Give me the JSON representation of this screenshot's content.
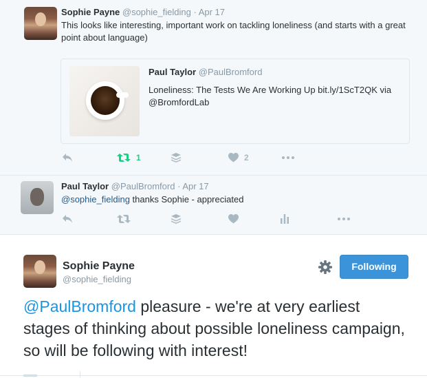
{
  "tweet1": {
    "name": "Sophie Payne",
    "handle": "@sophie_fielding",
    "dot": "·",
    "date": "Apr 17",
    "text": "This looks like interesting, important work on tackling loneliness (and starts with a great point about language)",
    "quote": {
      "name": "Paul Taylor",
      "handle": "@PaulBromford",
      "text": "Loneliness: The Tests We Are Working Up bit.ly/1ScT2QK via @BromfordLab"
    },
    "retweet_count": "1",
    "like_count": "2"
  },
  "tweet2": {
    "name": "Paul Taylor",
    "handle": "@PaulBromford",
    "dot": "·",
    "date": "Apr 17",
    "mention": "@sophie_fielding",
    "text": " thanks Sophie - appreciated"
  },
  "main": {
    "name": "Sophie Payne",
    "handle": "@sophie_fielding",
    "follow_label": "Following",
    "mention": "@PaulBromford",
    "text": " pleasure - we're at very earliest stages of thinking about possible loneliness campaign, so will be following with interest!"
  },
  "icons": {
    "reply": "reply-icon",
    "retweet": "retweet-icon",
    "buffer": "buffer-icon",
    "like": "heart-icon",
    "analytics": "analytics-icon",
    "more": "more-icon",
    "gear": "gear-icon"
  },
  "colors": {
    "accent": "#1b95e0",
    "button": "#3b94d9",
    "retweet_active": "#19cf86",
    "muted": "#8899a6",
    "icon": "#aab8c2"
  }
}
